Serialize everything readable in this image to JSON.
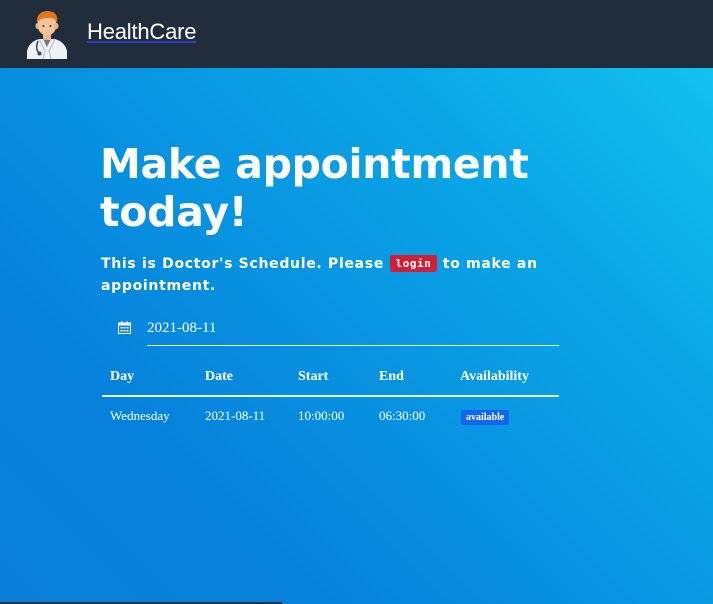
{
  "navbar": {
    "brand_name": "HealthCare",
    "logo_icon": "doctor-avatar-icon"
  },
  "hero": {
    "title": "Make appointment today!",
    "subtitle_before": "This is Doctor's Schedule. Please ",
    "login_label": "login",
    "subtitle_after": " to make an appointment."
  },
  "date_picker": {
    "icon": "calendar-icon",
    "value": "2021-08-11"
  },
  "schedule": {
    "headers": [
      "Day",
      "Date",
      "Start",
      "End",
      "Availability"
    ],
    "rows": [
      {
        "day": "Wednesday",
        "date": "2021-08-11",
        "start": "10:00:00",
        "end": "06:30:00",
        "availability": "available"
      }
    ]
  },
  "colors": {
    "navbar": "#222d3c",
    "background_start": "#14c6f0",
    "background_end": "#0782dc",
    "login_badge": "#d11f37",
    "available_badge": "#1466f0"
  }
}
